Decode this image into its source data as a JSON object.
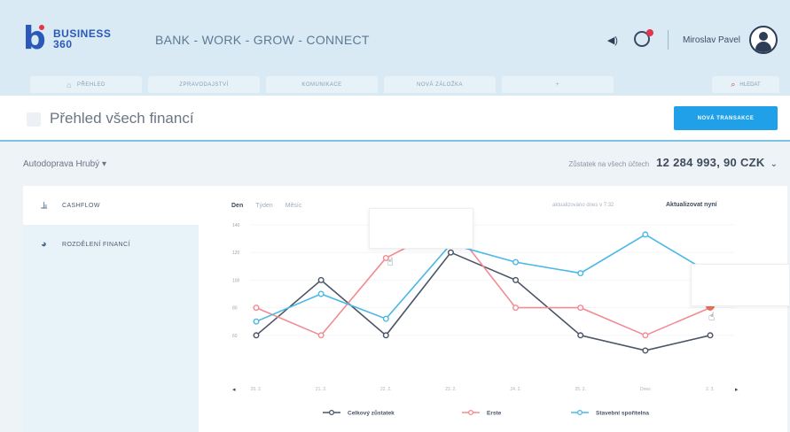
{
  "header": {
    "logo": {
      "mark": "b",
      "line1": "BUSINESS",
      "line2": "360"
    },
    "tagline": "BANK - WORK - GROW - CONNECT",
    "user_name": "Miroslav Pavel",
    "nav_tabs": [
      {
        "label": "Přehled",
        "icon": "home-icon"
      },
      {
        "label": "Zpravodajství",
        "icon": ""
      },
      {
        "label": "Komunikace",
        "icon": ""
      },
      {
        "label": "Nová záložka",
        "icon": ""
      },
      {
        "label": "+",
        "icon": ""
      }
    ],
    "search_label": "Hledat"
  },
  "page": {
    "title": "Přehled všech financí",
    "new_transaction": "NOVÁ TRANSAKCE"
  },
  "account": {
    "name": "Autodoprava Hrubý",
    "balance_label": "Zůstatek na všech účtech",
    "balance_value": "12 284 993, 90 CZK"
  },
  "sidebar": {
    "items": [
      {
        "label": "CASHFLOW",
        "icon": "line-chart-icon"
      },
      {
        "label": "ROZDĚLENÍ FINANCÍ",
        "icon": "pie-chart-icon"
      }
    ]
  },
  "chart_controls": {
    "periods": [
      "Den",
      "Týden",
      "Měsíc"
    ],
    "active_period": "Den",
    "updated": "aktualizováno dnes v 7:32",
    "refresh": "Aktualizovat nyní"
  },
  "chart_data": {
    "type": "line",
    "x": [
      "20. 2.",
      "21. 2.",
      "22. 2.",
      "23. 2.",
      "24. 2.",
      "25. 2.",
      "Dnes",
      "2. 3."
    ],
    "ylim": [
      0,
      140
    ],
    "yticks": [
      140,
      120,
      100,
      80,
      60
    ],
    "series": [
      {
        "name": "Celkový zůstatek",
        "color": "#4a5566",
        "values": [
          60,
          100,
          60,
          120,
          100,
          60,
          49,
          60
        ]
      },
      {
        "name": "Erste",
        "color": "#f28b94",
        "values": [
          80,
          60,
          116,
          140,
          80,
          80,
          60,
          80
        ]
      },
      {
        "name": "Stavební spořitelna",
        "color": "#4bb8e6",
        "values": [
          70,
          90,
          72,
          126,
          113,
          105,
          133,
          105
        ]
      }
    ]
  }
}
